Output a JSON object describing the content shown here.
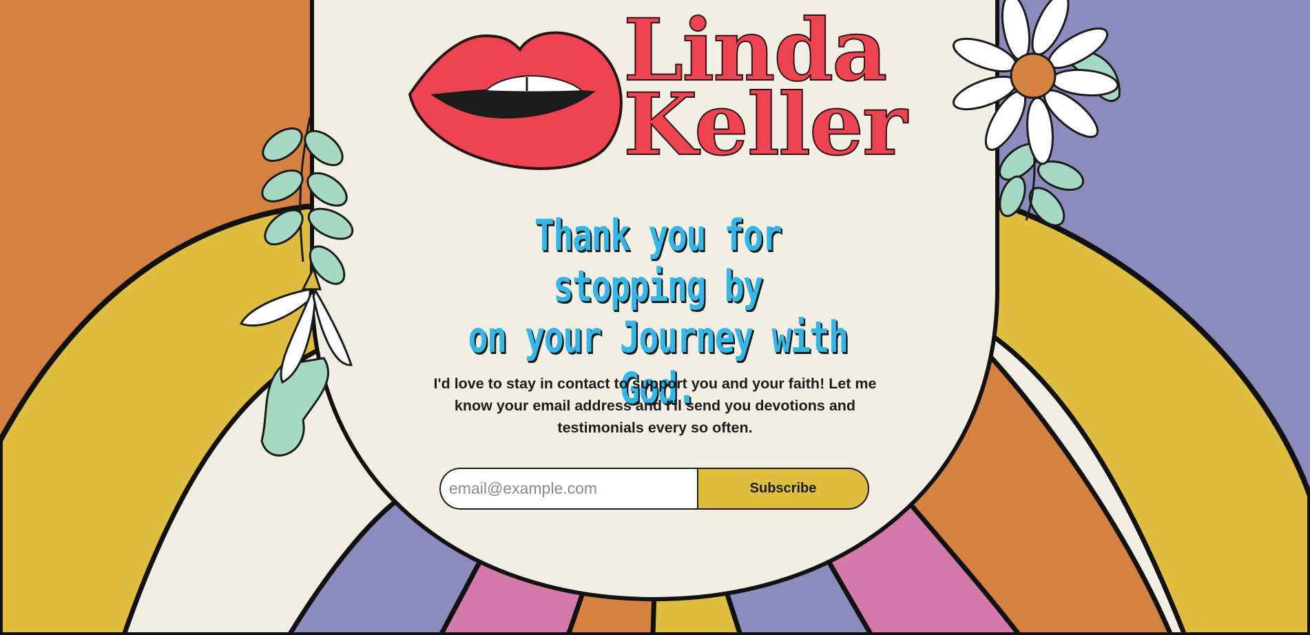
{
  "brand": {
    "name_line1": "Linda",
    "name_line2": "Keller",
    "logo_icon": "lips-icon"
  },
  "hero": {
    "headline_line1": "Thank you for stopping by",
    "headline_line2": "on your Journey with God."
  },
  "intro": {
    "text": "I'd love to stay in contact to support you and your faith! Let me know your email address and I'll send you devotions and testimonials every so often."
  },
  "signup": {
    "email_placeholder": "email@example.com",
    "email_value": "",
    "subscribe_label": "Subscribe"
  },
  "decor": {
    "left_sprig": "daisy-sprig-icon",
    "right_flower": "daisy-flower-icon"
  },
  "colors": {
    "orange": "#d58142",
    "yellow": "#dfbd3e",
    "cream": "#f1eee3",
    "lavender": "#8b8bbe",
    "pink": "#d47aab",
    "red": "#ee4452",
    "blue": "#35b6e6",
    "mint": "#a5d9c5",
    "outline": "#1b1b1b"
  }
}
